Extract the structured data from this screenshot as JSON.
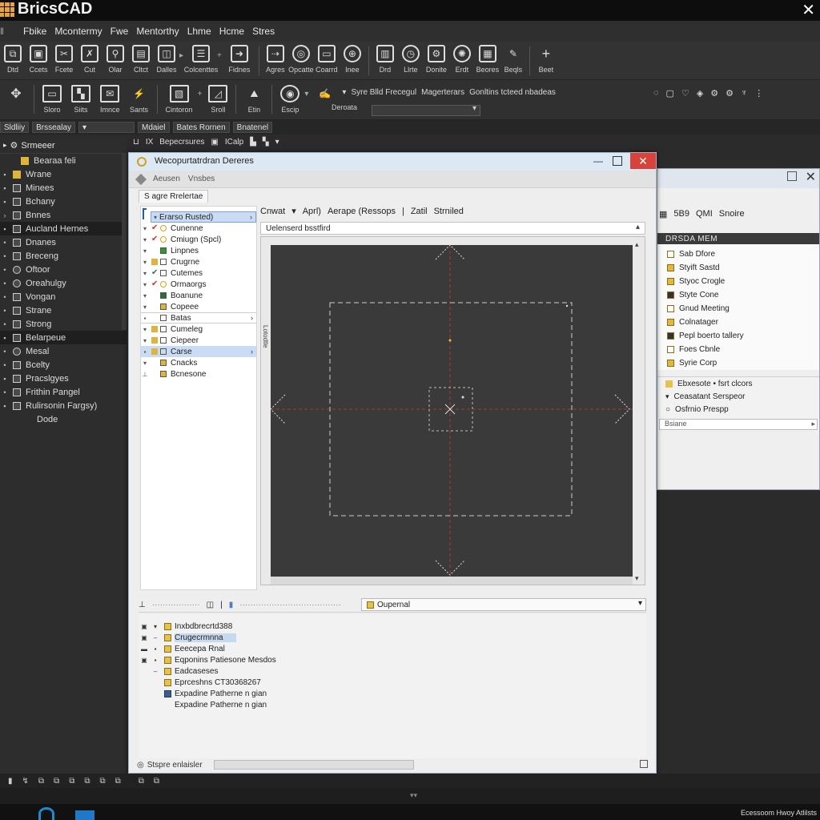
{
  "app": {
    "title": "BricsCAD"
  },
  "menubar": [
    "Fbike",
    "Mcontermy",
    "Fwe",
    "Mentorthy",
    "Lhme",
    "Hcme",
    "Stres"
  ],
  "ribbon1": {
    "buttons": [
      "Dtd",
      "Ccets",
      "Fcete",
      "Cut",
      "Olar",
      "Cltct",
      "Dalles",
      "Colcenttes",
      "Fidnes",
      "Agres",
      "Opcatte",
      "Coarrd",
      "Inee",
      "Drd",
      "Llrte",
      "Donite",
      "Erdt",
      "Beores",
      "Beqls",
      "Beet"
    ],
    "icons": [
      "copy-icon",
      "paste-icon",
      "cut-icon",
      "scissors-icon",
      "pin-icon",
      "document-icon",
      "layer-icon",
      "columns-icon",
      "arrow-icon",
      "link-icon",
      "circle-target-icon",
      "chat-icon",
      "globe-icon",
      "page-icon",
      "clock-icon",
      "gear-search-icon",
      "gear-icon",
      "grid-icon",
      "pen-icon",
      "plus-icon"
    ]
  },
  "ribbon2": {
    "buttons": [
      "Sloro",
      "Siits",
      "Imnce",
      "Sants",
      "Cintoron",
      "Sroll",
      "Etin",
      "Escip",
      "Deroata"
    ],
    "text1": "Syre Blld Frecegul",
    "text2": "Magerterars",
    "text3": "Gonltins tcteed nbadeas"
  },
  "propbar": [
    "Sldliiy",
    "Brssealay",
    "Mdaiel",
    "Bates Rornen",
    "Bnatenel"
  ],
  "leftpanel": {
    "header": "Srmeeer",
    "items": [
      {
        "label": "Bearaa feli"
      },
      {
        "label": "Wrane"
      },
      {
        "label": "Minees"
      },
      {
        "label": "Bchany"
      },
      {
        "label": "Bnnes"
      },
      {
        "label": "Aucland Hernes"
      },
      {
        "label": "Dnanes"
      },
      {
        "label": "Breceng"
      },
      {
        "label": "Oftoor"
      },
      {
        "label": "Oreahulgy"
      },
      {
        "label": "Vongan"
      },
      {
        "label": "Strane"
      },
      {
        "label": "Strong"
      },
      {
        "label": "Belarpeue"
      },
      {
        "label": "Mesal"
      },
      {
        "label": "Bcelty"
      },
      {
        "label": "Pracslgyes"
      },
      {
        "label": "Frithin Pangel"
      },
      {
        "label": "Rulirsonin Fargsy)"
      },
      {
        "label": "Dode"
      }
    ],
    "toolbar": [
      "IX",
      "Bepecrsures",
      "ICalp"
    ]
  },
  "dialog": {
    "title": "Wecopurtatrdran Dereres",
    "tabs": [
      "Aeusen",
      "Vnsbes"
    ],
    "subtab": "S agre Rrelertae",
    "tree": [
      {
        "label": "Erarso Rusted)",
        "selected": true,
        "chevron": true
      },
      {
        "label": "Cunenne"
      },
      {
        "label": "Cmiugn (Spcl)"
      },
      {
        "label": "Linpnes"
      },
      {
        "label": "Crugrne"
      },
      {
        "label": "Cutemes"
      },
      {
        "label": "Ormaorgs"
      },
      {
        "label": "Boanune"
      },
      {
        "label": "Copeee"
      },
      {
        "label": "Batas",
        "chevron": true
      },
      {
        "label": "Cumeleg"
      },
      {
        "label": "Ciepeer"
      },
      {
        "label": "Carse",
        "selected": true,
        "chevron": true
      },
      {
        "label": "Cnacks"
      },
      {
        "label": "Bcnesone"
      }
    ],
    "viewport": {
      "toolbar": [
        "Cnwat",
        "Aprl)",
        "Aerape (Ressops",
        "Zatil",
        "Strniled"
      ],
      "combo": "Uelenserd bsstfird",
      "ruler": "Lotodtle"
    },
    "bottom": {
      "combo": "Oupernal",
      "items": [
        {
          "label": "Inxbdbrecrtd388"
        },
        {
          "label": "Crugecrmnna",
          "selected": true
        },
        {
          "label": "Eeecepa Rnal"
        },
        {
          "label": "Eqponins Patiesone Mesdos"
        },
        {
          "label": "Eadcaseses"
        },
        {
          "label": "Eprceshns CT30368267"
        },
        {
          "label": "Expadine Patherne n gian"
        },
        {
          "label": "Expadine Patherne n gian"
        }
      ]
    },
    "status": "Stspre enlaisler"
  },
  "dialog2": {
    "toolbar": [
      "5B9",
      "QMI",
      "Snoire"
    ],
    "header": "DRSDA MEM",
    "items": [
      "Sab Dfore",
      "Styift Sastd",
      "Styoc Crogle",
      "Styte Cone",
      "Gnud Meeting",
      "Colnatager",
      "Pepl boerto tallery",
      "Foes Cbnle",
      "Syrie Corp"
    ],
    "rows": [
      "Ebxesote • fsrt clcors",
      "Ceasatant Serspeor",
      "Osfrnio Prespp"
    ],
    "status": "Bsiane"
  },
  "taskbar": {
    "right": "Ecessoom Hwoy Atlilsts"
  },
  "colors": {
    "accent": "#d9413b",
    "selection": "#c9dcf4",
    "crosshair": "#a23a3a"
  }
}
